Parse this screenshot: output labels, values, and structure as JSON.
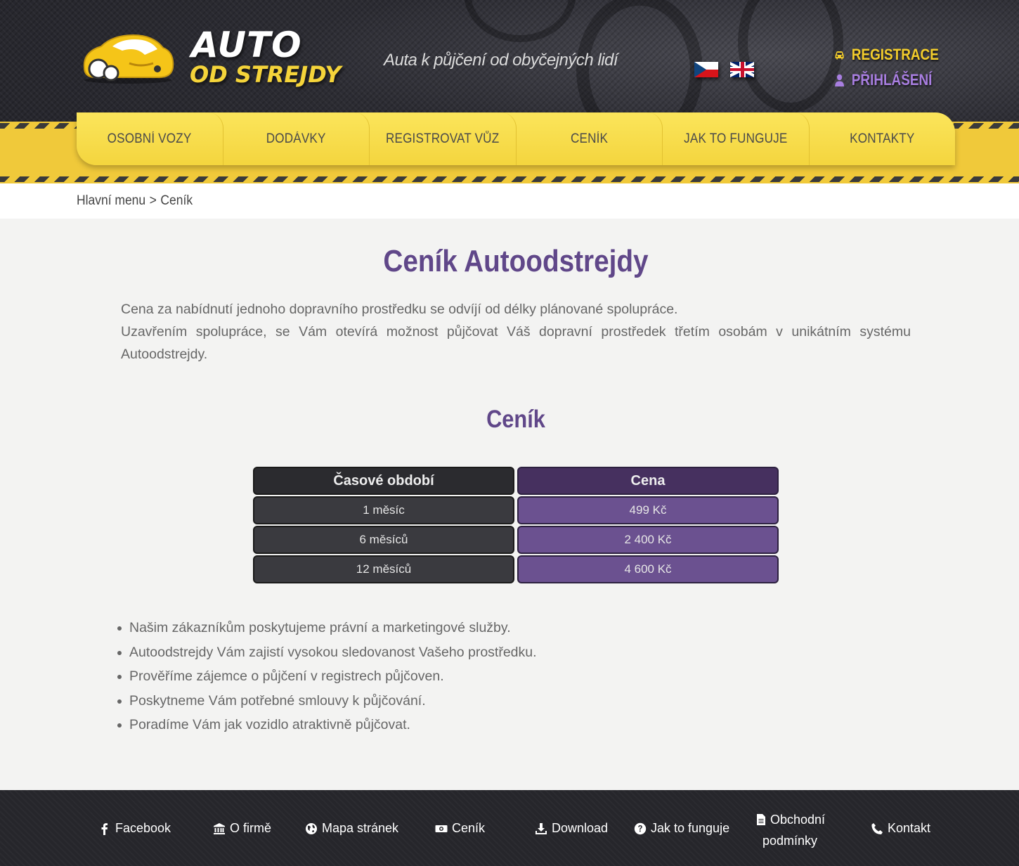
{
  "header": {
    "logo_line1": "AUTO",
    "logo_line2": "OD STREJDY",
    "tagline": "Auta k půjčení od obyčejných lidí",
    "auth": {
      "register_label": "REGISTRACE",
      "login_label": "PŘIHLÁŠENÍ"
    },
    "colors": {
      "accent_yellow": "#f3cd2b",
      "accent_purple": "#a87ee0",
      "dark_bg": "#2c2c33"
    }
  },
  "nav": {
    "items": [
      {
        "label": "OSOBNÍ VOZY"
      },
      {
        "label": "DODÁVKY"
      },
      {
        "label": "REGISTROVAT VŮZ"
      },
      {
        "label": "CENÍK"
      },
      {
        "label": "JAK TO FUNGUJE"
      },
      {
        "label": "KONTAKTY"
      }
    ]
  },
  "breadcrumb": {
    "home": "Hlavní menu",
    "separator": ">",
    "current": "Ceník"
  },
  "main": {
    "title": "Ceník Autoodstrejdy",
    "intro": [
      "Cena za nabídnutí jednoho dopravního prostředku se odvíjí od délky plánované spolupráce.",
      "Uzavřením spolupráce, se Vám otevírá možnost půjčovat Váš dopravní prostředek třetím osobám v unikátním systému Autoodstrejdy."
    ],
    "section_title": "Ceník",
    "table": {
      "headers": [
        "Časové období",
        "Cena"
      ],
      "rows": [
        [
          "1 měsíc",
          "499 Kč"
        ],
        [
          "6 měsíců",
          "2 400 Kč"
        ],
        [
          "12 měsíců",
          "4 600 Kč"
        ]
      ]
    },
    "benefits": [
      "Našim zákazníkům poskytujeme právní a marketingové služby.",
      "Autoodstrejdy Vám zajistí vysokou sledovanost Vašeho prostředku.",
      "Prověříme zájemce o půjčení v registrech půjčoven.",
      "Poskytneme Vám potřebné smlouvy k půjčování.",
      "Poradíme Vám jak vozidlo atraktivně půjčovat."
    ]
  },
  "footer": {
    "links": [
      {
        "label": "Facebook",
        "icon": "facebook-icon"
      },
      {
        "label": "O firmě",
        "icon": "bank-icon"
      },
      {
        "label": "Mapa stránek",
        "icon": "globe-icon"
      },
      {
        "label": "Ceník",
        "icon": "money-icon"
      },
      {
        "label": "Download",
        "icon": "download-icon"
      },
      {
        "label": "Jak to funguje",
        "icon": "question-icon"
      },
      {
        "label_line1": "Obchodní",
        "label_line2": "podmínky",
        "icon": "document-icon"
      },
      {
        "label": "Kontakt",
        "icon": "phone-icon"
      }
    ]
  }
}
